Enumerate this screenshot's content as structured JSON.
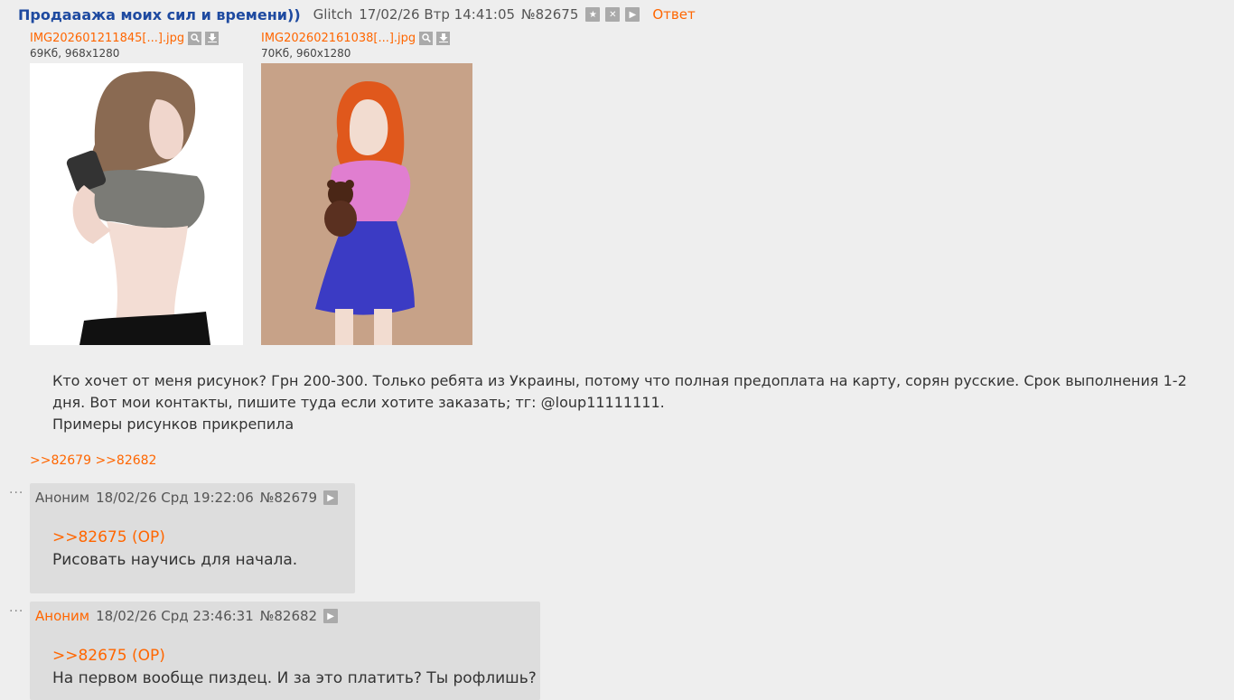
{
  "op": {
    "title": "Продааажа моих сил и времени))",
    "name": "Glitch",
    "date": "17/02/26 Втр 14:41:05",
    "number": "№82675",
    "reply_label": "Ответ",
    "files": [
      {
        "name": "IMG202601211845[...].jpg",
        "meta": "69Кб, 968x1280"
      },
      {
        "name": "IMG202602161038[...].jpg",
        "meta": "70Кб, 960x1280"
      }
    ],
    "text_line1": "Кто хочет от меня рисунок? Грн 200-300. Только ребята из Украины, потому что полная предоплата на карту, сорян русские. Срок выполнения 1-2",
    "text_line2": "дня. Вот мои контакты, пишите туда если хотите заказать; тг: @loup11111111.",
    "text_line3": "Примеры рисунков прикрепила",
    "backlinks": [
      ">>82679",
      ">>82682"
    ]
  },
  "replies": [
    {
      "name": "Аноним",
      "date": "18/02/26 Срд 19:22:06",
      "number": "№82679",
      "quote": ">>82675 (OP)",
      "text": "Рисовать научись для начала."
    },
    {
      "name": "Аноним",
      "date": "18/02/26 Срд 23:46:31",
      "number": "№82682",
      "quote": ">>82675 (OP)",
      "text": "На первом вообще пиздец. И за это платить? Ты рофлишь?"
    }
  ],
  "icons": {
    "star": "star-icon",
    "close": "close-icon",
    "play": "play-icon",
    "search": "search-icon",
    "download": "download-icon",
    "dots": "ellipsis-icon"
  },
  "colors": {
    "accent": "#ff6600",
    "title": "#1e4aa0",
    "background": "#eeeeee",
    "reply_bg": "#dddddd"
  }
}
